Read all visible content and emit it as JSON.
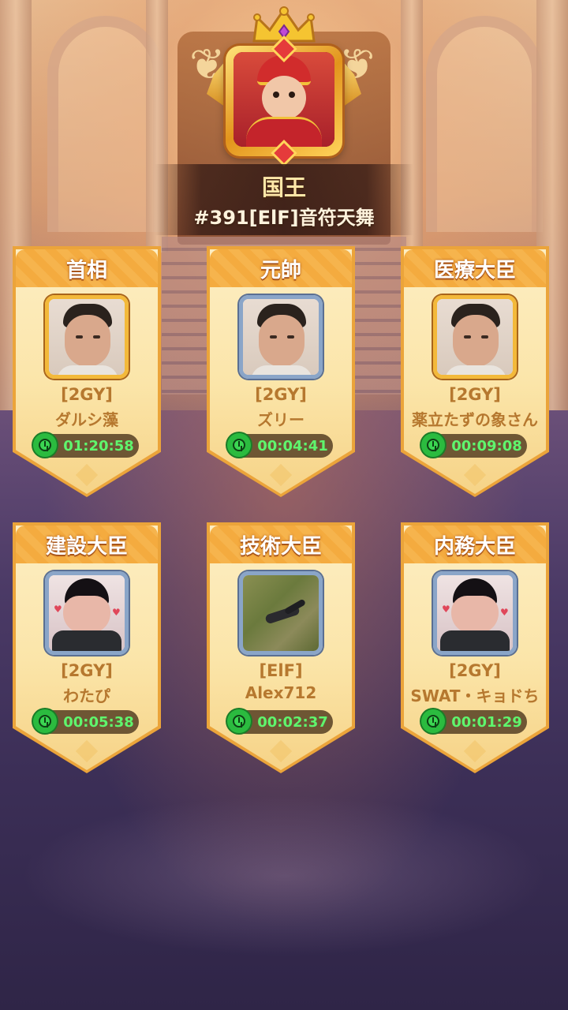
{
  "king": {
    "title": "国王",
    "player": "#391[ElF]音符天舞"
  },
  "ministers": [
    {
      "role": "首相",
      "guild": "[2GY]",
      "name": "ダルシ藻",
      "timer": "01:20:58",
      "frame": "gold",
      "avatar": "man-photo-icon"
    },
    {
      "role": "元帥",
      "guild": "[2GY]",
      "name": "ズリー",
      "timer": "00:04:41",
      "frame": "blue",
      "avatar": "man-photo-icon"
    },
    {
      "role": "医療大臣",
      "guild": "[2GY]",
      "name": "薬立たずの象さん",
      "timer": "00:09:08",
      "frame": "gold",
      "avatar": "man-photo-icon"
    },
    {
      "role": "建設大臣",
      "guild": "[2GY]",
      "name": "わたぴ",
      "timer": "00:05:38",
      "frame": "blue",
      "avatar": "bowl-cut-photo-icon"
    },
    {
      "role": "技術大臣",
      "guild": "[ElF]",
      "name": "Alex712",
      "timer": "00:02:37",
      "frame": "blue",
      "avatar": "grass-photo-icon"
    },
    {
      "role": "内務大臣",
      "guild": "[2GY]",
      "name": "SWAT・キョドち",
      "timer": "00:01:29",
      "frame": "blue",
      "avatar": "bowl-cut-photo-icon"
    }
  ],
  "colors": {
    "card_bg": "#fbe5a9",
    "card_header": "#f4ab3f",
    "text_brown": "#b6782f",
    "timer_green": "#5ff56d"
  }
}
